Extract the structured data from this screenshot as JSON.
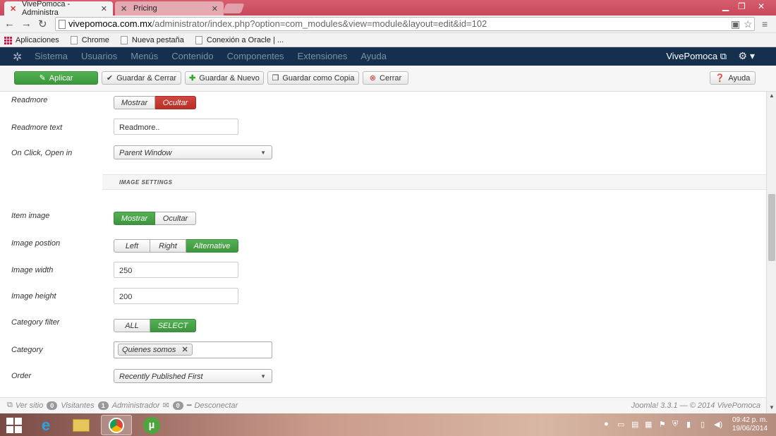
{
  "browser": {
    "tabs": [
      {
        "label": "VivePomoca - Administra",
        "active": true
      },
      {
        "label": "Pricing",
        "active": false
      }
    ],
    "url_domain": "vivepomoca.com.mx",
    "url_path": "/administrator/index.php?option=com_modules&view=module&layout=edit&id=102",
    "bookmarks": [
      {
        "label": "Aplicaciones",
        "icon": "apps-grid-icon"
      },
      {
        "label": "Chrome",
        "icon": "page-icon"
      },
      {
        "label": "Nueva pestaña",
        "icon": "page-icon"
      },
      {
        "label": "Conexión a Oracle | ...",
        "icon": "page-icon"
      }
    ]
  },
  "navbar": {
    "menu": [
      "Sistema",
      "Usuarios",
      "Menús",
      "Contenido",
      "Componentes",
      "Extensiones",
      "Ayuda"
    ],
    "site": "VivePomoca ⧉"
  },
  "toolbar": {
    "apply": "Aplicar",
    "save_close": "Guardar & Cerrar",
    "save_new": "Guardar & Nuevo",
    "save_copy": "Guardar como Copia",
    "close": "Cerrar",
    "help": "Ayuda"
  },
  "form": {
    "readmore": {
      "label": "Readmore",
      "options": [
        "Mostrar",
        "Ocultar"
      ],
      "selected": "Ocultar"
    },
    "readmore_text": {
      "label": "Readmore text",
      "value": "Readmore.."
    },
    "on_click": {
      "label": "On Click, Open in",
      "value": "Parent Window"
    },
    "section": "IMAGE SETTINGS",
    "item_image": {
      "label": "Item image",
      "options": [
        "Mostrar",
        "Ocultar"
      ],
      "selected": "Mostrar"
    },
    "image_position": {
      "label": "Image postion",
      "options": [
        "Left",
        "Right",
        "Alternative"
      ],
      "selected": "Alternative"
    },
    "image_width": {
      "label": "Image width",
      "value": "250"
    },
    "image_height": {
      "label": "Image height",
      "value": "200"
    },
    "category_filter": {
      "label": "Category filter",
      "options": [
        "ALL",
        "SELECT"
      ],
      "selected": "SELECT"
    },
    "category": {
      "label": "Category",
      "chip": "Quienes somos"
    },
    "order": {
      "label": "Order",
      "value": "Recently Published First"
    }
  },
  "statusbar": {
    "view_site": "Ver sitio",
    "visitors_count": "0",
    "visitors": "Visitantes",
    "admin_count": "1",
    "admin": "Administrador",
    "msg_count": "0",
    "logout": "Desconectar",
    "version": "Joomla! 3.3.1 — © 2014 VivePomoca"
  },
  "taskbar": {
    "time": "09:42 p. m.",
    "date": "19/06/2014"
  }
}
